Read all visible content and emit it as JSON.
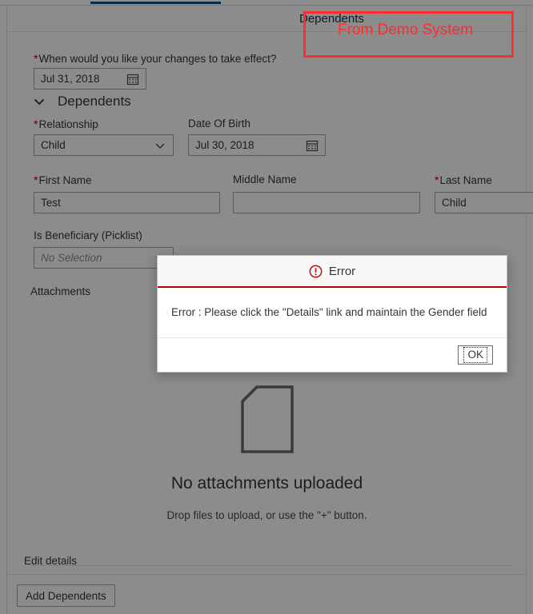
{
  "header": {
    "title": "Dependents"
  },
  "annotation": {
    "text": "From Demo System",
    "color": "#ff2d2d"
  },
  "form": {
    "effective_date": {
      "label": "When would you like your changes to take effect?",
      "required": true,
      "value": "Jul 31, 2018",
      "icon": "calendar-icon"
    },
    "section": {
      "title": "Dependents",
      "expanded": true,
      "icon": "chevron-down-icon"
    },
    "relationship": {
      "label": "Relationship",
      "required": true,
      "value": "Child",
      "icon": "chevron-down-icon"
    },
    "date_of_birth": {
      "label": "Date Of Birth",
      "required": false,
      "value": "Jul 30, 2018",
      "icon": "calendar-icon"
    },
    "first_name": {
      "label": "First Name",
      "required": true,
      "value": "Test"
    },
    "middle_name": {
      "label": "Middle Name",
      "required": false,
      "value": ""
    },
    "last_name": {
      "label": "Last Name",
      "required": true,
      "value": "Child"
    },
    "is_beneficiary": {
      "label": "Is Beneficiary (Picklist)",
      "required": false,
      "value": "No Selection",
      "is_placeholder": true,
      "icon": "chevron-down-icon"
    }
  },
  "attachments": {
    "label": "Attachments",
    "empty_title": "No attachments uploaded",
    "empty_hint": "Drop files to upload, or use the \"+\" button.",
    "icon": "document-icon"
  },
  "links": {
    "edit_details": "Edit details"
  },
  "footer": {
    "add_dependents": "Add Dependents"
  },
  "dialog": {
    "title": "Error",
    "icon": "error-circle-icon",
    "message": "Error : Please click the \"Details\" link and maintain the Gender field",
    "ok_label": "OK",
    "accent_color": "#bb0000"
  }
}
